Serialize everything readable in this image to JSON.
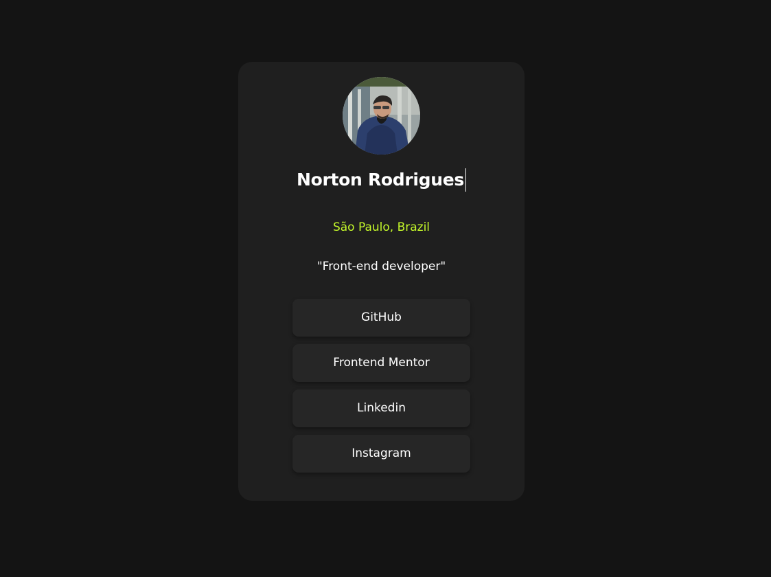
{
  "profile": {
    "name": "Norton Rodrigues",
    "location": "São Paulo, Brazil",
    "bio": "\"Front-end developer\"",
    "avatar_alt": "profile photo"
  },
  "links": [
    {
      "label": "GitHub"
    },
    {
      "label": "Frontend Mentor"
    },
    {
      "label": "Linkedin"
    },
    {
      "label": "Instagram"
    }
  ],
  "colors": {
    "background": "#141414",
    "card": "#1f1f1f",
    "button": "#262626",
    "accent": "#c4f82a",
    "text": "#ffffff"
  }
}
